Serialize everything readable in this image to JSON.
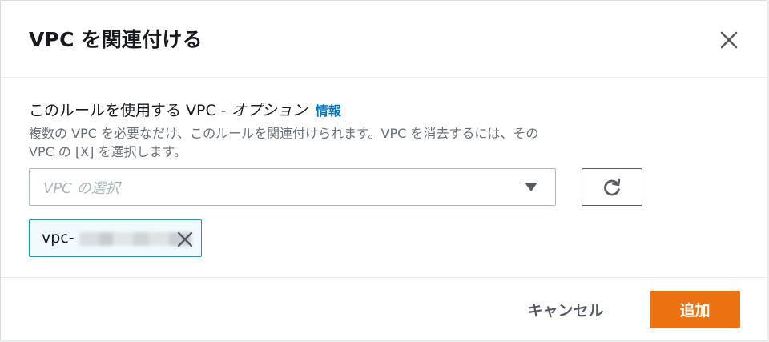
{
  "modal": {
    "title": "VPC を関連付ける",
    "close_icon": "close-icon"
  },
  "field": {
    "label": "このルールを使用する VPC - ",
    "label_optional": "オプション",
    "info_link": "情報",
    "description": "複数の VPC を必要なだけ、このルールを関連付けられます。VPC を消去するには、その VPC の [X] を選択します。",
    "select_placeholder": "VPC の選択",
    "dropdown_icon": "caret-down-icon",
    "refresh_icon": "refresh-icon"
  },
  "selected_tokens": [
    {
      "label": "vpc-",
      "redacted": true,
      "remove_icon": "close-icon"
    }
  ],
  "footer": {
    "cancel_label": "キャンセル",
    "add_label": "追加"
  },
  "colors": {
    "primary_button": "#ec7211",
    "link": "#0073bb",
    "token_border": "#00a1c9",
    "token_background": "#f1faff"
  }
}
